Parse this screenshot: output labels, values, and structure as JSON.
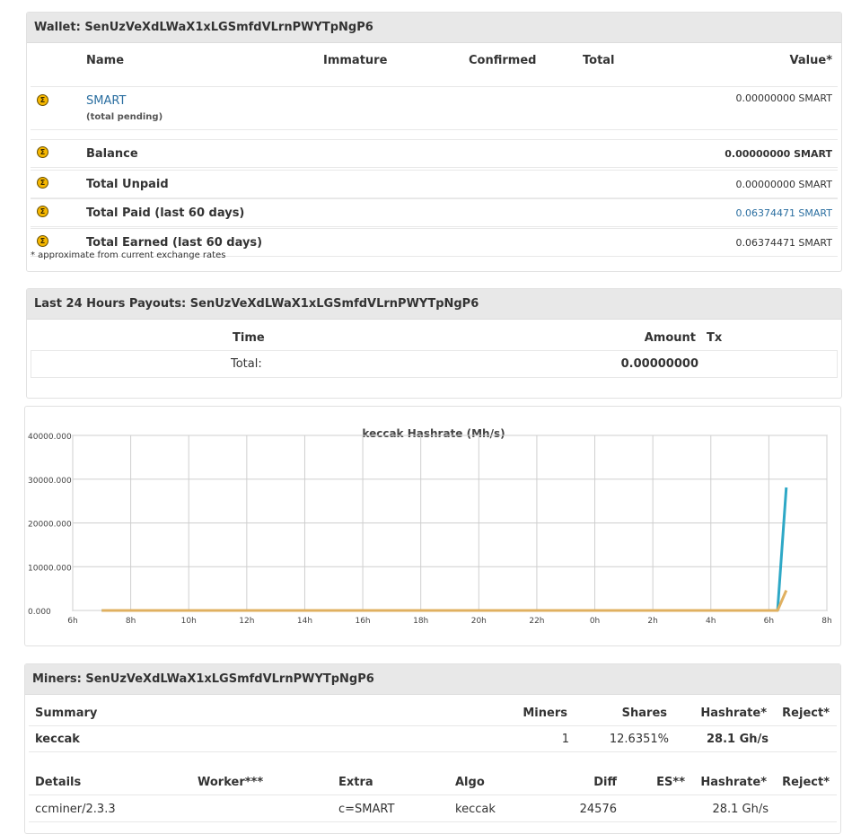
{
  "wallet": {
    "title": "Wallet: SenUzVeXdLWaX1xLGSmfdVLrnPWYTpNgP6",
    "columns": [
      "Name",
      "Immature",
      "Confirmed",
      "Total",
      "Value*"
    ],
    "coin_name": "SMART",
    "coin_sub": "(total pending)",
    "coin_value": "0.00000000 SMART",
    "rows": [
      {
        "label": "Balance",
        "value": "0.00000000 SMART"
      },
      {
        "label": "Total Unpaid",
        "value": "0.00000000 SMART"
      },
      {
        "label": "Total Paid (last 60 days)",
        "value": "0.06374471 SMART"
      },
      {
        "label": "Total Earned (last 60 days)",
        "value": "0.06374471 SMART"
      }
    ],
    "note": "* approximate from current exchange rates",
    "coin_icon": "smartcash-coin-icon",
    "link_color": "#2a6ea0"
  },
  "payouts": {
    "title": "Last 24 Hours Payouts: SenUzVeXdLWaX1xLGSmfdVLrnPWYTpNgP6",
    "col_time": "Time",
    "col_amount": "Amount",
    "col_tx": "Tx",
    "total_label": "Total:",
    "total_value": "0.00000000"
  },
  "chart_data": {
    "type": "line",
    "title": "keccak Hashrate (Mh/s)",
    "xlabel": "",
    "ylabel": "",
    "x_ticks": [
      "6h",
      "8h",
      "10h",
      "12h",
      "14h",
      "16h",
      "18h",
      "20h",
      "22h",
      "0h",
      "2h",
      "4h",
      "6h",
      "8h"
    ],
    "y_ticks": [
      "0.000",
      "10000.000",
      "20000.000",
      "30000.000",
      "40000.000"
    ],
    "ylim": [
      0,
      40000
    ],
    "xlim": [
      0,
      26
    ],
    "grid": true,
    "series": [
      {
        "color": "#2ea8c6",
        "x": [
          1.0,
          24.3,
          24.6
        ],
        "y": [
          0,
          0,
          28100
        ]
      },
      {
        "color": "#e0b060",
        "x": [
          1.0,
          24.3,
          24.6
        ],
        "y": [
          0,
          0,
          4600
        ]
      }
    ]
  },
  "miners": {
    "title": "Miners: SenUzVeXdLWaX1xLGSmfdVLrnPWYTpNgP6",
    "summary_headers": {
      "summary": "Summary",
      "miners": "Miners",
      "shares": "Shares",
      "hashrate": "Hashrate*",
      "reject": "Reject*"
    },
    "summary_row": {
      "algo": "keccak",
      "miners": "1",
      "shares": "12.6351%",
      "hashrate": "28.1 Gh/s",
      "reject": ""
    },
    "details_headers": {
      "details": "Details",
      "worker": "Worker***",
      "extra": "Extra",
      "algo": "Algo",
      "diff": "Diff",
      "es": "ES**",
      "hashrate": "Hashrate*",
      "reject": "Reject*"
    },
    "details_row": {
      "details": "ccminer/2.3.3",
      "worker": "",
      "extra": "c=SMART",
      "algo": "keccak",
      "diff": "24576",
      "es": "",
      "hashrate": "28.1 Gh/s",
      "reject": ""
    }
  }
}
